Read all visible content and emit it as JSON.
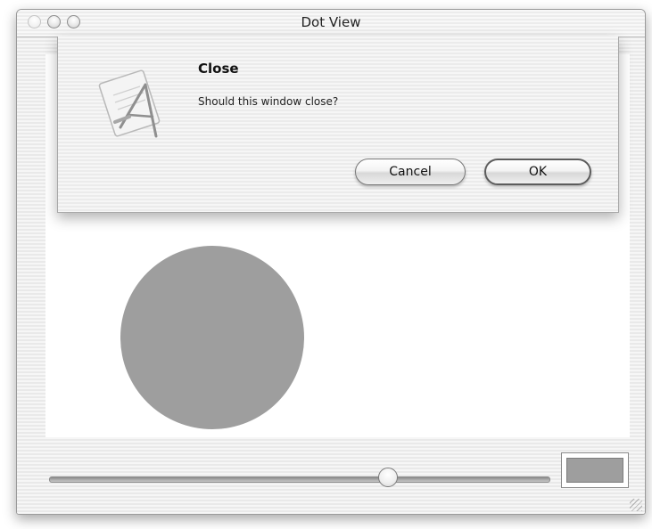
{
  "window": {
    "title": "Dot View"
  },
  "dialog": {
    "title": "Close",
    "message": "Should this window close?",
    "cancel_label": "Cancel",
    "ok_label": "OK",
    "icon": "app-icon"
  },
  "dot": {
    "color": "#9e9e9e"
  },
  "color_well": {
    "color": "#9e9e9e"
  },
  "slider": {
    "value_fraction": 0.68
  }
}
